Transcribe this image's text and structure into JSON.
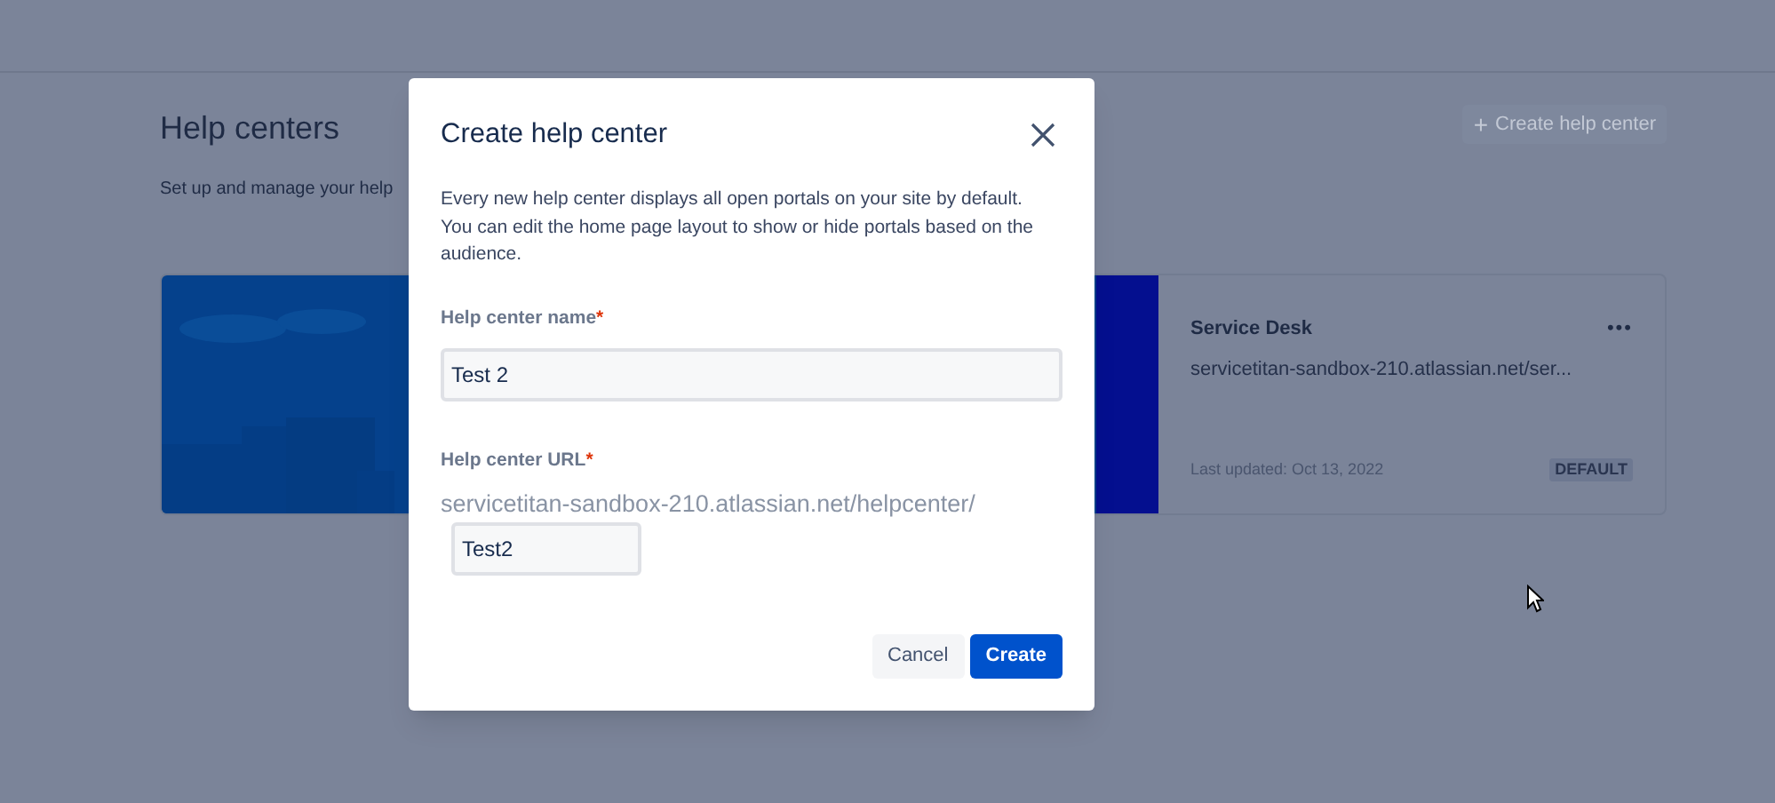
{
  "page": {
    "title": "Help centers",
    "subtitle": "Set up and manage your help",
    "create_button": {
      "label": "Create help center",
      "icon": "+"
    }
  },
  "help_center_card": {
    "name": "Service Desk",
    "url": "servicetitan-sandbox-210.atlassian.net/ser...",
    "menu": "•••",
    "updated": "Last updated: Oct 13, 2022",
    "badge": "DEFAULT"
  },
  "dialog": {
    "title": "Create help center",
    "description": "Every new help center displays all open portals on your site by default. You can edit the home page layout to show or hide portals based on the audience.",
    "fields": [
      {
        "label": "Help center name",
        "required_mark": "*",
        "value": "Test 2"
      },
      {
        "label": "Help center URL",
        "required_mark": "*",
        "prefix": "servicetitan-sandbox-210.atlassian.net/helpcenter/",
        "value": "Test2"
      }
    ],
    "buttons": [
      {
        "label": "Cancel",
        "kind": "secondary"
      },
      {
        "label": "Create",
        "kind": "primary"
      }
    ]
  }
}
